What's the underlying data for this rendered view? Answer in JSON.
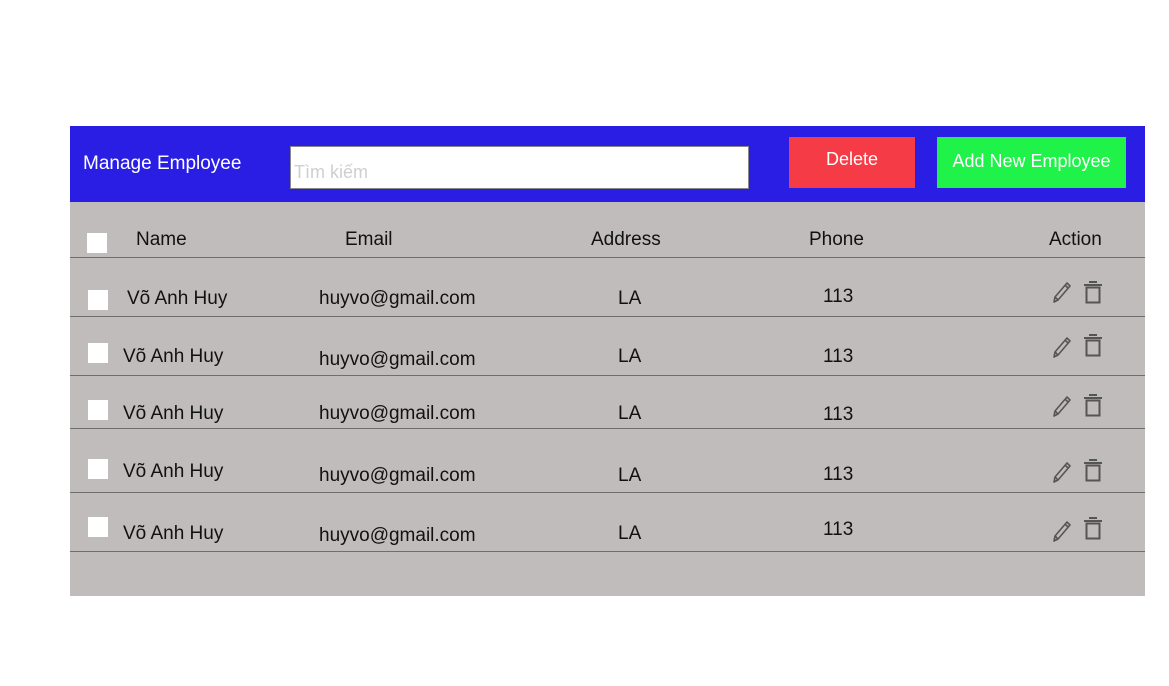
{
  "header": {
    "title": "Manage Employee",
    "search_placeholder": "Tìm kiếm",
    "delete_label": "Delete",
    "add_label": "Add New Employee"
  },
  "columns": {
    "name": "Name",
    "email": "Email",
    "address": "Address",
    "phone": "Phone",
    "action": "Action"
  },
  "rows": [
    {
      "name": "Võ Anh Huy",
      "email": "huyvo@gmail.com",
      "address": "LA",
      "phone": "113"
    },
    {
      "name": "Võ Anh Huy",
      "email": "huyvo@gmail.com",
      "address": "LA",
      "phone": "113"
    },
    {
      "name": "Võ Anh Huy",
      "email": "huyvo@gmail.com",
      "address": "LA",
      "phone": "113"
    },
    {
      "name": "Võ Anh Huy",
      "email": "huyvo@gmail.com",
      "address": "LA",
      "phone": "113"
    },
    {
      "name": "Võ Anh Huy",
      "email": "huyvo@gmail.com",
      "address": "LA",
      "phone": "113"
    }
  ],
  "colors": {
    "topbar": "#2a1ee4",
    "panel": "#c1bcbc",
    "delete": "#f53b45",
    "add": "#1ff248"
  },
  "icons": {
    "edit": "pencil-icon",
    "delete": "trash-icon"
  }
}
